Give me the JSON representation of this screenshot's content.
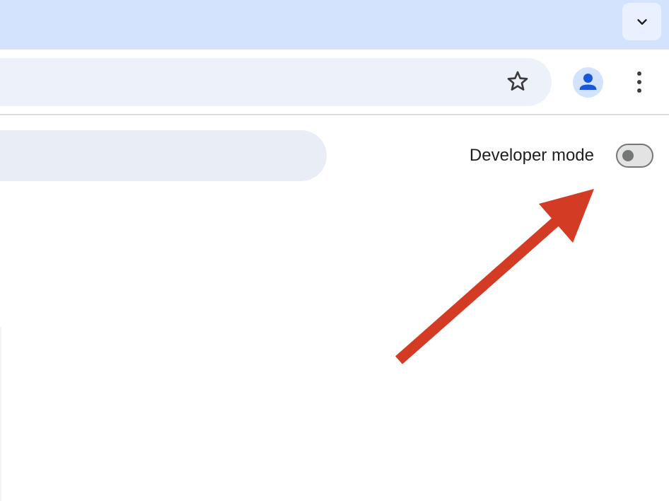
{
  "tab_strip": {
    "tab_search_icon": "chevron-down-icon"
  },
  "toolbar": {
    "bookmark_icon": "star-outline-icon",
    "profile_icon": "person-icon",
    "menu_icon": "three-dots-vertical-icon"
  },
  "extensions_page": {
    "developer_mode_label": "Developer mode",
    "developer_mode_enabled": false
  },
  "annotation": {
    "type": "arrow",
    "points_to": "developer-mode-toggle",
    "color": "#d33b24"
  },
  "colors": {
    "tab_strip": "#d3e3fd",
    "omnibox": "#edf2fa",
    "search_bar": "#e9edf6",
    "avatar_bg": "#d3e3fd",
    "avatar_fg": "#1a56db",
    "toggle_off": "#747775"
  }
}
